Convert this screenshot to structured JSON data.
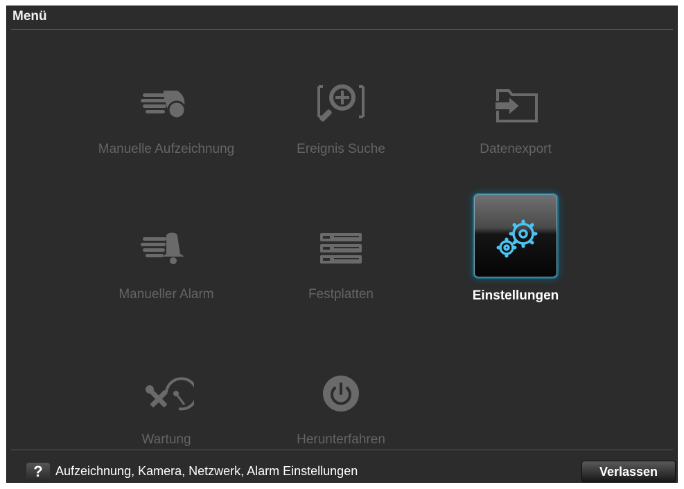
{
  "window": {
    "title": "Menü"
  },
  "menu": {
    "items": [
      {
        "label": "Manuelle Aufzeichnung",
        "icon": "hand-record-icon"
      },
      {
        "label": "Ereignis Suche",
        "icon": "search-plus-icon"
      },
      {
        "label": "Datenexport",
        "icon": "folder-export-icon"
      },
      {
        "label": "Manueller Alarm",
        "icon": "hand-bell-icon"
      },
      {
        "label": "Festplatten",
        "icon": "hdd-stack-icon"
      },
      {
        "label": "Einstellungen",
        "icon": "gears-icon",
        "selected": true
      },
      {
        "label": "Wartung",
        "icon": "tools-disk-icon"
      },
      {
        "label": "Herunterfahren",
        "icon": "power-icon"
      }
    ]
  },
  "footer": {
    "help_glyph": "?",
    "status": "Aufzeichnung, Kamera, Netzwerk, Alarm Einstellungen",
    "exit_label": "Verlassen"
  },
  "colors": {
    "background": "#2c2c2c",
    "inactive_label": "#646464",
    "selected_label": "#ffffff",
    "selected_glow": "#1f6f8c",
    "gear_blue": "#4cc3f2"
  }
}
